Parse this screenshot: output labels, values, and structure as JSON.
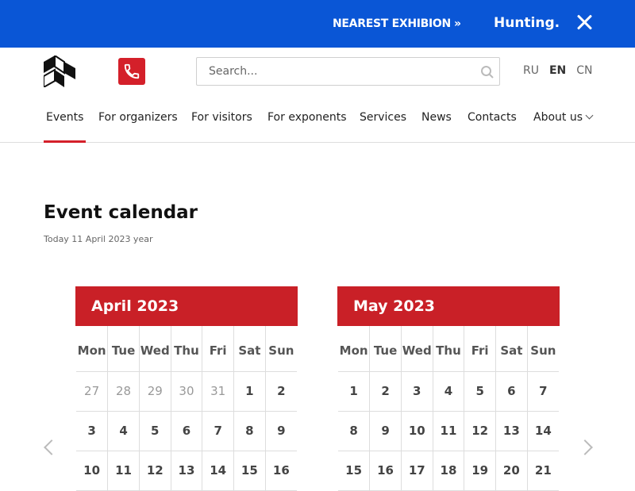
{
  "topbar": {
    "nearest_label": "NEAREST EXHIBION",
    "nearest_chevron": "»",
    "ticker_text": "Hunting. Fishing",
    "close_icon": "close-icon",
    "background": "#0a56d6"
  },
  "header": {
    "logo_icon": "logo-icon",
    "phone_icon": "phone-icon",
    "search_placeholder": "Search...",
    "search_icon": "search-icon",
    "languages": [
      "RU",
      "EN",
      "CN"
    ],
    "active_language": "EN"
  },
  "nav": {
    "items": [
      "Events",
      "For organizers",
      "For visitors",
      "For exponents",
      "Services",
      "News",
      "Contacts",
      "About us"
    ],
    "active": "Events",
    "accent": "#d4202a"
  },
  "main": {
    "title": "Event calendar",
    "today": "Today 11 April 2023 year"
  },
  "calendars": [
    {
      "month": "April 2023",
      "weekdays": [
        "Mon",
        "Tue",
        "Wed",
        "Thu",
        "Fri",
        "Sat",
        "Sun"
      ],
      "weeks": [
        [
          "27",
          "28",
          "29",
          "30",
          "31",
          "1",
          "2"
        ],
        [
          "3",
          "4",
          "5",
          "6",
          "7",
          "8",
          "9"
        ],
        [
          "10",
          "11",
          "12",
          "13",
          "14",
          "15",
          "16"
        ]
      ],
      "other_month_count": 5
    },
    {
      "month": "May 2023",
      "weekdays": [
        "Mon",
        "Tue",
        "Wed",
        "Thu",
        "Fri",
        "Sat",
        "Sun"
      ],
      "weeks": [
        [
          "1",
          "2",
          "3",
          "4",
          "5",
          "6",
          "7"
        ],
        [
          "8",
          "9",
          "10",
          "11",
          "12",
          "13",
          "14"
        ],
        [
          "15",
          "16",
          "17",
          "18",
          "19",
          "20",
          "21"
        ]
      ],
      "other_month_count": 0
    }
  ],
  "carousel": {
    "prev_icon": "chevron-left-icon",
    "next_icon": "chevron-right-icon"
  }
}
